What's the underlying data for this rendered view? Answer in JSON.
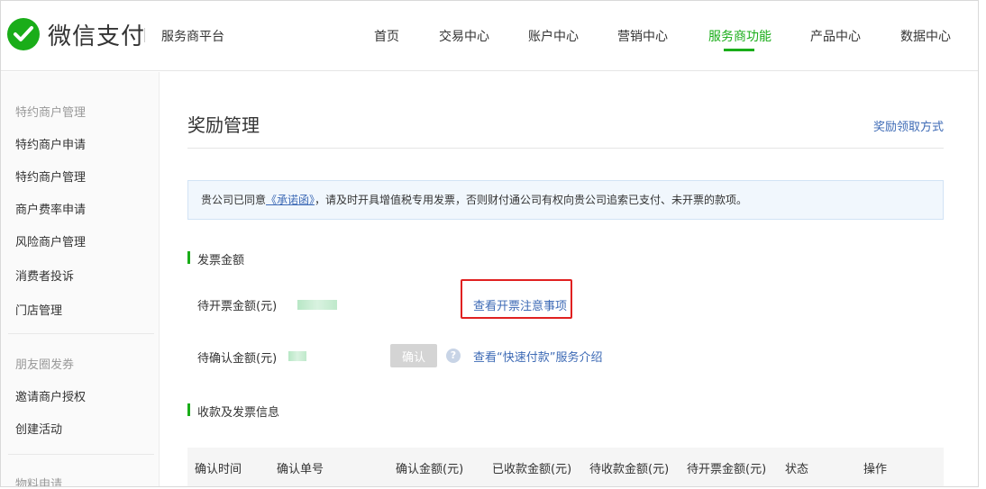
{
  "header": {
    "brand": "微信支付",
    "platform": "服务商平台",
    "nav": [
      "首页",
      "交易中心",
      "账户中心",
      "营销中心",
      "服务商功能",
      "产品中心",
      "数据中心"
    ],
    "active_nav": "服务商功能",
    "accent_color": "#1aad19"
  },
  "sidebar": {
    "group1": "特约商户管理",
    "items1": [
      "特约商户申请",
      "特约商户管理",
      "商户费率申请",
      "风险商户管理",
      "消费者投诉",
      "门店管理"
    ],
    "group2": "朋友圈发券",
    "items2": [
      "邀请商户授权",
      "创建活动"
    ],
    "group3": "物料申请"
  },
  "main": {
    "title": "奖励管理",
    "reward_link": "奖励领取方式",
    "notice": {
      "prefix": "贵公司已同意",
      "link": "《承诺函》",
      "suffix": "，请及时开具增值税专用发票，否则财付通公司有权向贵公司追索已支付、未开票的款项。"
    },
    "invoice_section": {
      "title": "发票金额",
      "pending_invoice_label": "待开票金额(元)",
      "invoice_tips_link": "查看开票注意事项",
      "pending_confirm_label": "待确认金额(元)",
      "confirm_button": "确认",
      "help_icon": "?",
      "quick_pay_link": "查看“快速付款”服务介绍"
    },
    "payment_section": {
      "title": "收款及发票信息",
      "columns": [
        "确认时间",
        "确认单号",
        "确认金额(元)",
        "已收款金额(元)",
        "待收款金额(元)",
        "待开票金额(元)",
        "状态",
        "操作"
      ]
    }
  }
}
